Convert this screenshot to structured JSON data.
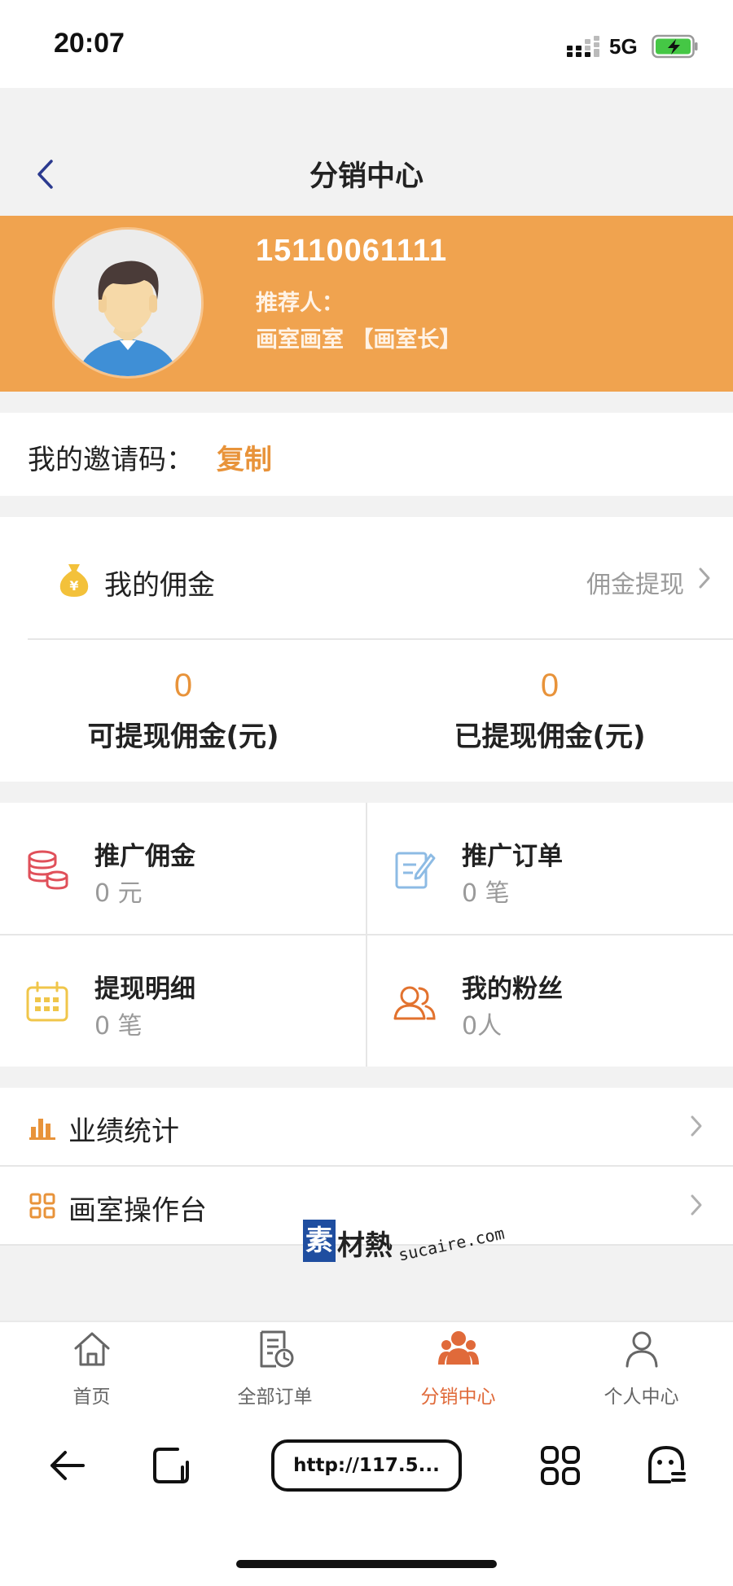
{
  "status_bar": {
    "time": "20:07",
    "network": "5G",
    "icons": [
      "signal-icon",
      "battery-charging-icon"
    ]
  },
  "nav": {
    "title": "分销中心",
    "back_icon": "chevron-left-icon"
  },
  "profile": {
    "phone": "15110061111",
    "referrer_label": "推荐人：",
    "studio": "画室画室 【画室长】",
    "banner_color": "#f0a34f"
  },
  "invite": {
    "label": "我的邀请码：",
    "copy_label": "复制"
  },
  "commission": {
    "icon": "moneybag-icon",
    "title": "我的佣金",
    "withdraw_label": "佣金提现",
    "withdrawable_value": "0",
    "withdrawable_label": "可提现佣金(元)",
    "withdrawn_value": "0",
    "withdrawn_label": "已提现佣金(元)"
  },
  "grid": [
    {
      "icon": "coins-stack-icon",
      "title": "推广佣金",
      "value": "0 元"
    },
    {
      "icon": "edit-note-icon",
      "title": "推广订单",
      "value": "0 笔"
    },
    {
      "icon": "calendar-icon",
      "title": "提现明细",
      "value": "0 笔"
    },
    {
      "icon": "users-icon",
      "title": "我的粉丝",
      "value": "0人"
    }
  ],
  "menu": [
    {
      "icon": "bar-chart-icon",
      "label": "业绩统计"
    },
    {
      "icon": "grid-icon",
      "label": "画室操作台"
    }
  ],
  "watermark": {
    "badge": "素",
    "text": "材熱",
    "domain": "sucaire.com"
  },
  "tabs": [
    {
      "icon": "home-icon",
      "label": "首页",
      "active": false
    },
    {
      "icon": "order-list-icon",
      "label": "全部订单",
      "active": false
    },
    {
      "icon": "team-icon",
      "label": "分销中心",
      "active": true
    },
    {
      "icon": "person-icon",
      "label": "个人中心",
      "active": false
    }
  ],
  "browser": {
    "url": "http://117.5..."
  },
  "colors": {
    "accent": "#e8933a",
    "active_tab": "#e06a3a"
  }
}
